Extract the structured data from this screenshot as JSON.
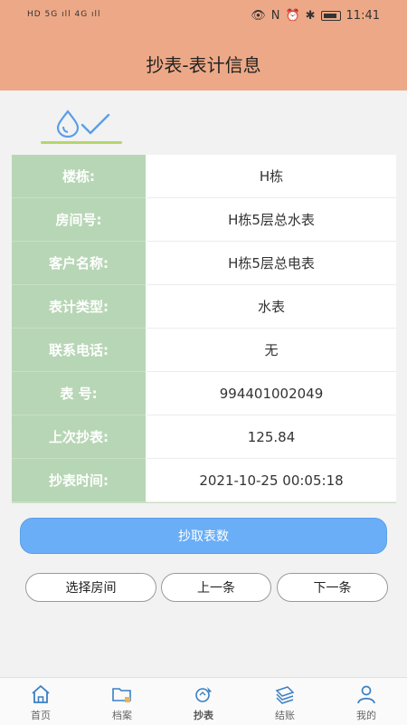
{
  "status_bar": {
    "left_text": "HD 5G ıll 4G ıll",
    "time": "11:41"
  },
  "page_title": "抄表-表计信息",
  "info_rows": [
    {
      "label": "楼栋:",
      "value": "H栋"
    },
    {
      "label": "房间号:",
      "value": "H栋5层总水表"
    },
    {
      "label": "客户名称:",
      "value": "H栋5层总电表"
    },
    {
      "label": "表计类型:",
      "value": "水表"
    },
    {
      "label": "联系电话:",
      "value": "无"
    },
    {
      "label": "表  号:",
      "value": "994401002049"
    },
    {
      "label": "上次抄表:",
      "value": "125.84"
    },
    {
      "label": "抄表时间:",
      "value": "2021-10-25 00:05:18"
    }
  ],
  "actions": {
    "read_meter": "抄取表数",
    "select_room": "选择房间",
    "prev": "上一条",
    "next": "下一条"
  },
  "bottom_nav": [
    {
      "label": "首页",
      "icon": "home-icon"
    },
    {
      "label": "档案",
      "icon": "folder-icon"
    },
    {
      "label": "抄表",
      "icon": "meter-reading-icon",
      "active": true
    },
    {
      "label": "结账",
      "icon": "billing-icon"
    },
    {
      "label": "我的",
      "icon": "user-icon"
    }
  ],
  "colors": {
    "header": "#eda987",
    "label_bg": "#b7d6b5",
    "primary_button": "#6aaef7",
    "tab_underline": "#b3d66b"
  }
}
